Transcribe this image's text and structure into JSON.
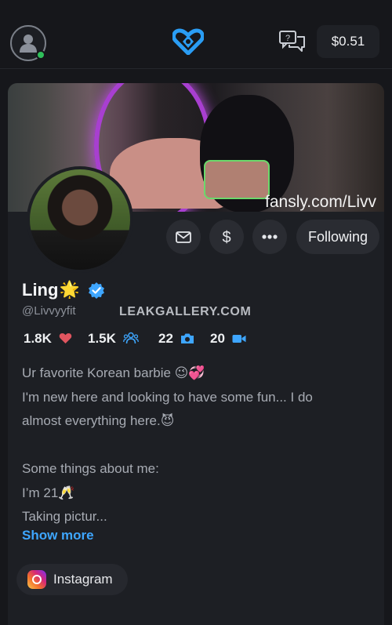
{
  "header": {
    "balance": "$0.51",
    "icons": {
      "avatar": "user-avatar-icon",
      "logo": "heart-logo-icon",
      "messages": "chat-bubbles-icon"
    }
  },
  "banner": {
    "watermark_text": "fansly.com/Livv"
  },
  "actions": {
    "follow_label": "Following"
  },
  "profile": {
    "name": "Ling",
    "name_emoji": "🌟",
    "handle": "@Livvyyfit",
    "verified_color": "#3ea6ff"
  },
  "overlay": {
    "watermark": "LEAKGALLERY.COM"
  },
  "stats": {
    "likes": "1.8K",
    "followers": "1.5K",
    "photos": "22",
    "videos": "20"
  },
  "bio": {
    "lines": [
      "Ur favorite Korean barbie 😉💞",
      "I'm new here and looking to have some fun... I do",
      "almost everything here.😈",
      "",
      "Some things about me:",
      "I’m 21🥂",
      "Taking pictur..."
    ],
    "show_more": "Show more"
  },
  "links": {
    "instagram": "Instagram"
  },
  "colors": {
    "accent": "#3ea6ff",
    "background": "#16171b",
    "card": "#1d1f24",
    "heart": "#e0555f"
  }
}
